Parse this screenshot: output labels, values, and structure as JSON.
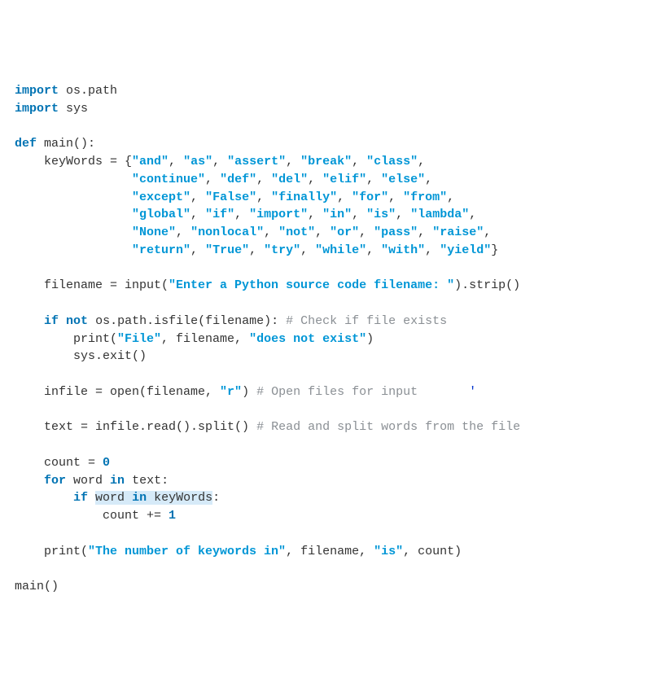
{
  "t": {
    "l1": {
      "kw1": "import",
      "s1": " os.path"
    },
    "l2": {
      "kw1": "import",
      "s1": " sys"
    },
    "l3": {
      "s1": ""
    },
    "l4": {
      "kw1": "def",
      "s1": " main():"
    },
    "l5": {
      "s1": "    keyWords = {",
      "str1": "\"and\"",
      "c1": ", ",
      "str2": "\"as\"",
      "c2": ", ",
      "str3": "\"assert\"",
      "c3": ", ",
      "str4": "\"break\"",
      "c4": ", ",
      "str5": "\"class\"",
      "c5": ","
    },
    "l6": {
      "s1": "                ",
      "str1": "\"continue\"",
      "c1": ", ",
      "str2": "\"def\"",
      "c2": ", ",
      "str3": "\"del\"",
      "c3": ", ",
      "str4": "\"elif\"",
      "c4": ", ",
      "str5": "\"else\"",
      "c5": ","
    },
    "l7": {
      "s1": "                ",
      "str1": "\"except\"",
      "c1": ", ",
      "str2": "\"False\"",
      "c2": ", ",
      "str3": "\"finally\"",
      "c3": ", ",
      "str4": "\"for\"",
      "c4": ", ",
      "str5": "\"from\"",
      "c5": ","
    },
    "l8": {
      "s1": "                ",
      "str1": "\"global\"",
      "c1": ", ",
      "str2": "\"if\"",
      "c2": ", ",
      "str3": "\"import\"",
      "c3": ", ",
      "str4": "\"in\"",
      "c4": ", ",
      "str5": "\"is\"",
      "c5": ", ",
      "str6": "\"lambda\"",
      "c6": ","
    },
    "l9": {
      "s1": "                ",
      "str1": "\"None\"",
      "c1": ", ",
      "str2": "\"nonlocal\"",
      "c2": ", ",
      "str3": "\"not\"",
      "c3": ", ",
      "str4": "\"or\"",
      "c4": ", ",
      "str5": "\"pass\"",
      "c5": ", ",
      "str6": "\"raise\"",
      "c6": ","
    },
    "l10": {
      "s1": "                ",
      "str1": "\"return\"",
      "c1": ", ",
      "str2": "\"True\"",
      "c2": ", ",
      "str3": "\"try\"",
      "c3": ", ",
      "str4": "\"while\"",
      "c4": ", ",
      "str5": "\"with\"",
      "c5": ", ",
      "str6": "\"yield\"",
      "c6": "}"
    },
    "l11": {
      "s1": ""
    },
    "l12": {
      "s1": "    filename = input(",
      "str1": "\"Enter a Python source code filename: \"",
      "s2": ").strip()"
    },
    "l13": {
      "s1": ""
    },
    "l14": {
      "s1": "    ",
      "kw1": "if",
      "s2": " ",
      "kw2": "not",
      "s3": " os.path.isfile(filename): ",
      "cmt1": "# Check if file exists"
    },
    "l15": {
      "s1": "        print(",
      "str1": "\"File\"",
      "s2": ", filename, ",
      "str2": "\"does not exist\"",
      "s3": ")"
    },
    "l16": {
      "s1": "        sys.exit()"
    },
    "l17": {
      "s1": ""
    },
    "l18": {
      "s1": "    infile = open(filename, ",
      "str1": "\"r\"",
      "s2": ") ",
      "cmt1": "# Open files for input",
      "s3": "       ",
      "caret": "'"
    },
    "l19": {
      "s1": ""
    },
    "l20": {
      "s1": "    text = infile.read().split()",
      "s2": " ",
      "cmt1": "# Read and split words from the file"
    },
    "l20b": {
      "s1": "                                 ",
      "caret": "'"
    },
    "l21": {
      "s1": ""
    },
    "l22": {
      "s1": "    count = ",
      "num1": "0"
    },
    "l23": {
      "s1": "    ",
      "kw1": "for",
      "s2": " word ",
      "kw2": "in",
      "s3": " text:"
    },
    "l24": {
      "s1": "        ",
      "kw1": "if",
      "s2": " ",
      "hl1": "word ",
      "kw2": "in",
      "hl2": " keyWords",
      "s3": ":"
    },
    "l25": {
      "s1": "            count += ",
      "num1": "1"
    },
    "l26": {
      "s1": ""
    },
    "l27": {
      "s1": "    print(",
      "str1": "\"The number of keywords in\"",
      "s2": ", filename, ",
      "str2": "\"is\"",
      "s3": ", count)"
    },
    "l28": {
      "s1": ""
    },
    "l29": {
      "s1": "main()"
    }
  }
}
